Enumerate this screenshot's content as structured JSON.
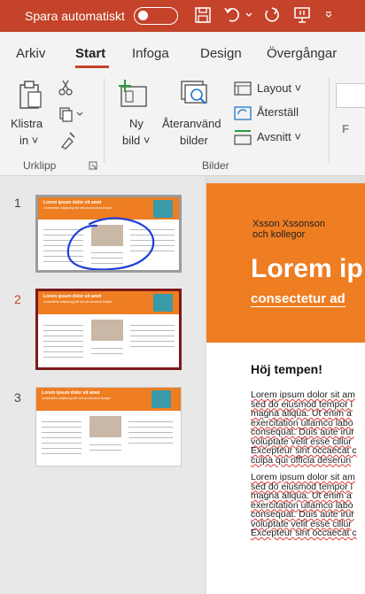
{
  "titlebar": {
    "autosave_label": "Spara automatiskt"
  },
  "tabs": [
    "Arkiv",
    "Start",
    "Infoga",
    "Design",
    "Övergångar"
  ],
  "ribbon": {
    "paste": [
      "Klistra",
      "in ˅"
    ],
    "new_slide": [
      "Ny",
      "bild ˅"
    ],
    "reuse": [
      "Återanvänd",
      "bilder"
    ],
    "layout": "Layout ˅",
    "reset": "Återställ",
    "section": "Avsnitt ˅",
    "font_letter": "F",
    "group_clipboard": "Urklipp",
    "group_slides": "Bilder"
  },
  "slides": [
    "1",
    "2",
    "3"
  ],
  "thumb_title": "Lorem ipsum dolor sit amet",
  "thumb_subtitle": "consectetur adipiscing elit sed do eiusmod tempor",
  "slide": {
    "author": [
      "Xsson Xssonson",
      "och kollegor"
    ],
    "title": "Lorem ip",
    "subtitle": "consectetur ad",
    "heading": "Höj tempen!",
    "para1": [
      "Lorem ipsum dolor sit am",
      "sed do eiusmod tempor i",
      "magna aliqua. Ut enim a",
      "exercitation ullamco labo",
      "consequat. Duis aute irur",
      "voluptate velit esse cillur",
      "Excepteur sint occaecat c",
      "culpa qui officia deserun"
    ],
    "para2": [
      "Lorem ipsum dolor sit am",
      "sed do eiusmod tempor i",
      "magna aliqua. Ut enim a",
      "exercitation ullamco labo",
      "consequat. Duis aute irur",
      "voluptate velit esse cillur",
      "Excepteur sint occaecat c"
    ]
  },
  "colors": {
    "accent": "#c4432a",
    "slide_orange": "#ef7d22",
    "ink": "#1f3fd6"
  }
}
